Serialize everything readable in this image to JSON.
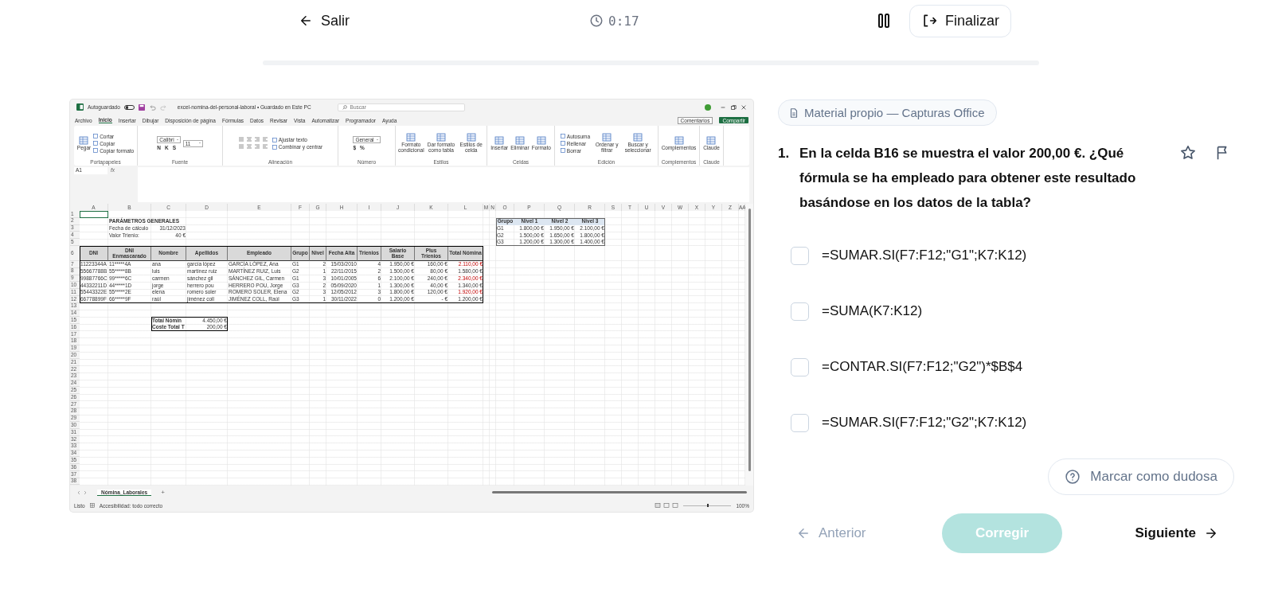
{
  "header": {
    "exit_label": "Salir",
    "timer": "0:17",
    "finish_label": "Finalizar"
  },
  "progress": {
    "level": 0
  },
  "excel": {
    "title_bar": {
      "autosave_label": "Autoguardado",
      "autosave_on": false,
      "file_title": "excel-nomina-del-personal-laboral • Guardado en Este PC",
      "search_placeholder": "Buscar"
    },
    "menu_tabs": [
      {
        "label": "Archivo",
        "selected": false
      },
      {
        "label": "Inicio",
        "selected": true
      },
      {
        "label": "Insertar",
        "selected": false
      },
      {
        "label": "Dibujar",
        "selected": false
      },
      {
        "label": "Disposición de página",
        "selected": false
      },
      {
        "label": "Fórmulas",
        "selected": false
      },
      {
        "label": "Datos",
        "selected": false
      },
      {
        "label": "Revisar",
        "selected": false
      },
      {
        "label": "Vista",
        "selected": false
      },
      {
        "label": "Automatizar",
        "selected": false
      },
      {
        "label": "Programador",
        "selected": false
      },
      {
        "label": "Ayuda",
        "selected": false
      }
    ],
    "comments_label": "Comentarios",
    "share_label": "Compartir",
    "ribbon_groups": [
      {
        "label": "Portapapeles",
        "columns": [
          [
            {
              "kind": "large",
              "label": "Pegar"
            }
          ],
          [
            {
              "kind": "small",
              "label": "Cortar"
            },
            {
              "kind": "small",
              "label": "Copiar"
            },
            {
              "kind": "small",
              "label": "Copiar formato"
            }
          ]
        ]
      },
      {
        "label": "Fuente",
        "columns": [
          [
            {
              "kind": "field",
              "label": "Calibri"
            },
            {
              "kind": "chars",
              "labels": [
                "N",
                "K",
                "S"
              ]
            }
          ],
          [
            {
              "kind": "field",
              "label": "11"
            }
          ]
        ]
      },
      {
        "label": "Alineación",
        "columns": [
          [
            {
              "kind": "icons"
            },
            {
              "kind": "icons"
            }
          ],
          [
            {
              "kind": "small",
              "label": "Ajustar texto"
            },
            {
              "kind": "small",
              "label": "Combinar y centrar"
            }
          ]
        ]
      },
      {
        "label": "Número",
        "columns": [
          [
            {
              "kind": "field",
              "label": "General"
            },
            {
              "kind": "chars",
              "labels": [
                "$",
                "%"
              ]
            }
          ]
        ]
      },
      {
        "label": "Estilos",
        "columns": [
          [
            {
              "kind": "large",
              "label": "Formato condicional"
            }
          ],
          [
            {
              "kind": "large",
              "label": "Dar formato como tabla"
            }
          ],
          [
            {
              "kind": "large",
              "label": "Estilos de celda"
            }
          ]
        ]
      },
      {
        "label": "Celdas",
        "columns": [
          [
            {
              "kind": "large",
              "label": "Insertar"
            }
          ],
          [
            {
              "kind": "large",
              "label": "Eliminar"
            }
          ],
          [
            {
              "kind": "large",
              "label": "Formato"
            }
          ]
        ]
      },
      {
        "label": "Edición",
        "columns": [
          [
            {
              "kind": "small",
              "label": "Autosuma"
            },
            {
              "kind": "small",
              "label": "Rellenar"
            },
            {
              "kind": "small",
              "label": "Borrar"
            }
          ],
          [
            {
              "kind": "large",
              "label": "Ordenar y filtrar"
            }
          ],
          [
            {
              "kind": "large",
              "label": "Buscar y seleccionar"
            }
          ]
        ]
      },
      {
        "label": "Complementos",
        "columns": [
          [
            {
              "kind": "large",
              "label": "Complementos"
            }
          ]
        ]
      },
      {
        "label": "Claude",
        "columns": [
          [
            {
              "kind": "large",
              "label": "Claude"
            }
          ]
        ]
      }
    ],
    "name_box": "A1",
    "function_label": "fx",
    "column_letters": [
      "A",
      "B",
      "C",
      "D",
      "E",
      "F",
      "G",
      "H",
      "I",
      "J",
      "K",
      "L",
      "M",
      "N",
      "O",
      "P",
      "Q",
      "R",
      "S",
      "T",
      "U",
      "V",
      "W",
      "X",
      "Y",
      "Z",
      "AA"
    ],
    "row_numbers": [
      "1",
      "2",
      "3",
      "4",
      "5",
      "6",
      "7",
      "8",
      "9",
      "10",
      "11",
      "12",
      "13",
      "14",
      "15",
      "16",
      "17",
      "18",
      "19",
      "20",
      "21",
      "22",
      "23",
      "24",
      "25",
      "26",
      "27",
      "28",
      "29",
      "30",
      "31",
      "32",
      "33",
      "34",
      "35",
      "36",
      "37",
      "38"
    ],
    "parameters": {
      "title": "PARÁMETROS GENERALES",
      "items": [
        {
          "label": "Fecha de cálculo",
          "value": "31/12/2023"
        },
        {
          "label": "Valor Trienio:",
          "value": "40 €"
        }
      ]
    },
    "employees": {
      "columns": [
        "DNI",
        "DNI Enmascarado",
        "Nombre",
        "Apellidos",
        "Empleado",
        "Grupo",
        "Nivel",
        "Fecha Alta",
        "Trienios",
        "Salario Base",
        "Plus Trienios",
        "Total Nómina"
      ],
      "rows": [
        {
          "cells": [
            "11223344A",
            "11*****4A",
            "ana",
            "garcía lópez",
            "GARCÍA LÓPEZ, Ana",
            "G1",
            "2",
            "15/03/2010",
            "4",
            "1.950,00 €",
            "160,00 €",
            "2.110,00 €"
          ],
          "total_highlighted": true
        },
        {
          "cells": [
            "55667788B",
            "55*****8B",
            "luis",
            "martínez ruiz",
            "MARTÍNEZ RUIZ, Luis",
            "G2",
            "1",
            "22/11/2015",
            "2",
            "1.500,00 €",
            "80,00 €",
            "1.580,00 €"
          ],
          "total_highlighted": false
        },
        {
          "cells": [
            "99887766C",
            "99*****6C",
            "carmen",
            "sánchez gil",
            "SÁNCHEZ GIL, Carmen",
            "G1",
            "3",
            "10/01/2005",
            "6",
            "2.100,00 €",
            "240,00 €",
            "2.340,00 €"
          ],
          "total_highlighted": true
        },
        {
          "cells": [
            "44332211D",
            "44*****1D",
            "jorge",
            "herrero pou",
            "HERRERO POU, Jorge",
            "G3",
            "2",
            "05/09/2020",
            "1",
            "1.300,00 €",
            "40,00 €",
            "1.340,00 €"
          ],
          "total_highlighted": false
        },
        {
          "cells": [
            "55443322E",
            "55*****2E",
            "elena",
            "romero soler",
            "ROMERO SOLER, Elena",
            "G2",
            "3",
            "12/05/2012",
            "3",
            "1.800,00 €",
            "120,00 €",
            "1.920,00 €"
          ],
          "total_highlighted": true
        },
        {
          "cells": [
            "66778899F",
            "66*****9F",
            "raúl",
            "jiménez coll",
            "JIMÉNEZ COLL, Raúl",
            "G3",
            "1",
            "30/11/2022",
            "0",
            "1.200,00 €",
            "- €",
            "1.200,00 €"
          ],
          "total_highlighted": false
        }
      ]
    },
    "totals": [
      {
        "label": "Total Nómin",
        "value": "4.450,00 €"
      },
      {
        "label": "Coste Total T",
        "value": "200,00 €"
      }
    ],
    "levels_table": {
      "columns": [
        "Grupo",
        "Nivel 1",
        "Nivel 2",
        "Nivel 3"
      ],
      "rows": [
        [
          "G1",
          "1.800,00 €",
          "1.950,00 €",
          "2.100,00 €"
        ],
        [
          "G2",
          "1.500,00 €",
          "1.650,00 €",
          "1.800,00 €"
        ],
        [
          "G3",
          "1.200,00 €",
          "1.300,00 €",
          "1.400,00 €"
        ]
      ]
    },
    "sheet_tabs": [
      {
        "label": "Nómina_Laborales",
        "selected": true
      }
    ],
    "add_sheet": "+",
    "status": {
      "ready": "Listo",
      "accessibility": "Accesibilidad: todo correcto",
      "zoom": {
        "level": 0.5,
        "reading": "100%"
      }
    }
  },
  "source_chip": "Material propio — Capturas Office",
  "question": {
    "number": "1.",
    "text": "En la celda B16 se muestra el valor 200,00 €. ¿Qué fórmula se ha empleado para obtener este resultado basándose en los datos de la tabla?",
    "starred": false,
    "flagged": false
  },
  "options": [
    {
      "label": "=SUMAR.SI(F7:F12;\"G1\";K7:K12)",
      "checked": false
    },
    {
      "label": "=SUMA(K7:K12)",
      "checked": false
    },
    {
      "label": "=CONTAR.SI(F7:F12;\"G2\")*$B$4",
      "checked": false
    },
    {
      "label": "=SUMAR.SI(F7:F12;\"G2\";K7:K12)",
      "checked": false
    }
  ],
  "doubt_button": "Marcar como dudosa",
  "nav": {
    "previous": {
      "label": "Anterior",
      "disabled": true
    },
    "check": {
      "label": "Corregir",
      "disabled": true
    },
    "next": {
      "label": "Siguiente",
      "disabled": false
    }
  }
}
